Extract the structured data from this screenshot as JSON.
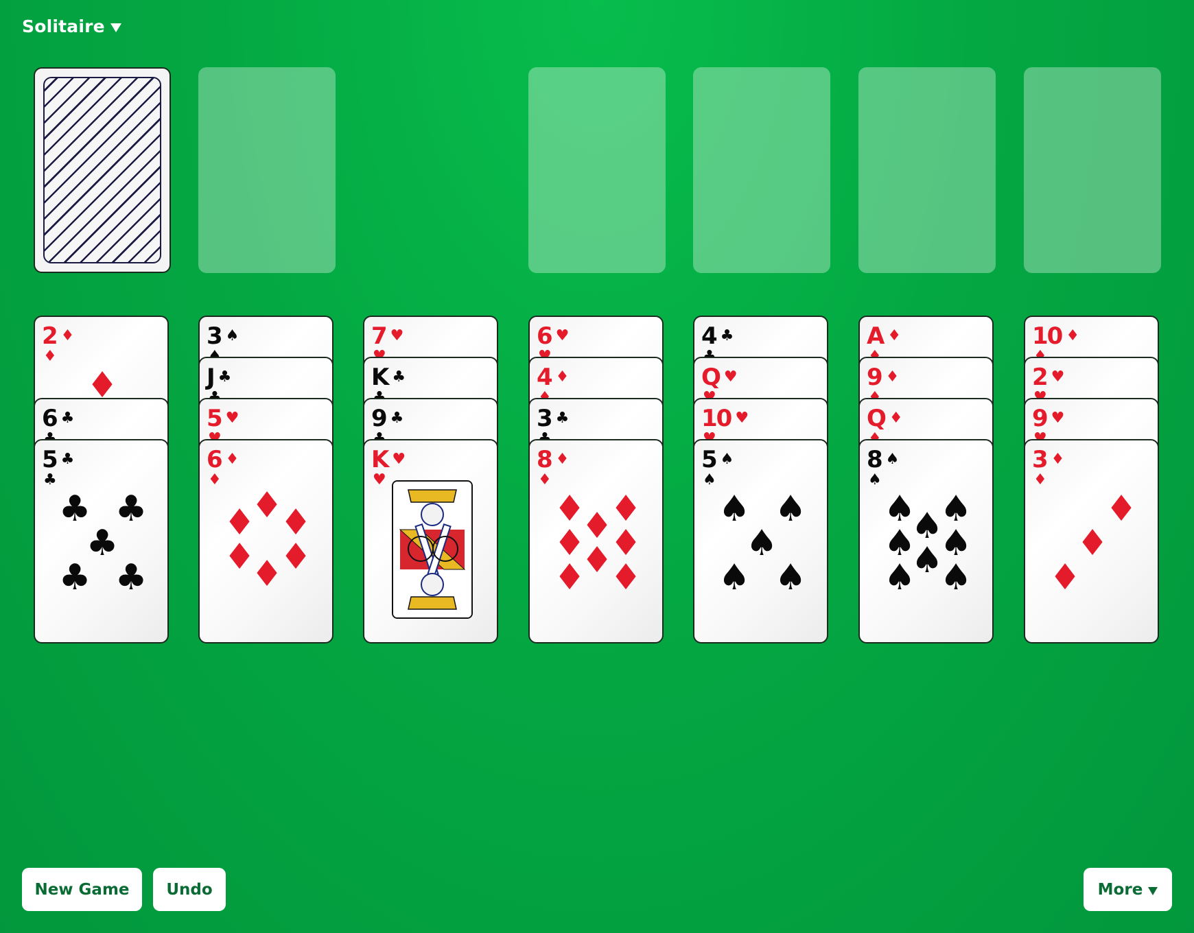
{
  "header": {
    "title": "Solitaire",
    "title_icon": "caret-down-icon"
  },
  "colors": {
    "table_green": "#04a843",
    "button_text": "#0b6b35",
    "red_suit": "#e41b2b",
    "black_suit": "#0a0a0a",
    "card_back_line": "#1a1a44"
  },
  "stock": {
    "face_down": true,
    "pattern": "diagonal-stripes"
  },
  "waste": {
    "empty": true
  },
  "foundations": [
    {
      "empty": true
    },
    {
      "empty": true
    },
    {
      "empty": true
    },
    {
      "empty": true
    }
  ],
  "tableau": [
    [
      {
        "rank": "2",
        "suit": "diamonds"
      },
      {
        "rank": "6",
        "suit": "clubs"
      },
      {
        "rank": "5",
        "suit": "clubs"
      }
    ],
    [
      {
        "rank": "3",
        "suit": "spades"
      },
      {
        "rank": "J",
        "suit": "clubs"
      },
      {
        "rank": "5",
        "suit": "hearts"
      },
      {
        "rank": "6",
        "suit": "diamonds"
      }
    ],
    [
      {
        "rank": "7",
        "suit": "hearts"
      },
      {
        "rank": "K",
        "suit": "clubs"
      },
      {
        "rank": "9",
        "suit": "clubs"
      },
      {
        "rank": "K",
        "suit": "hearts"
      }
    ],
    [
      {
        "rank": "6",
        "suit": "hearts"
      },
      {
        "rank": "4",
        "suit": "diamonds"
      },
      {
        "rank": "3",
        "suit": "clubs"
      },
      {
        "rank": "8",
        "suit": "diamonds"
      }
    ],
    [
      {
        "rank": "4",
        "suit": "clubs"
      },
      {
        "rank": "Q",
        "suit": "hearts"
      },
      {
        "rank": "10",
        "suit": "hearts"
      },
      {
        "rank": "5",
        "suit": "spades"
      }
    ],
    [
      {
        "rank": "A",
        "suit": "diamonds"
      },
      {
        "rank": "9",
        "suit": "diamonds"
      },
      {
        "rank": "Q",
        "suit": "diamonds"
      },
      {
        "rank": "8",
        "suit": "spades"
      }
    ],
    [
      {
        "rank": "10",
        "suit": "diamonds"
      },
      {
        "rank": "2",
        "suit": "hearts"
      },
      {
        "rank": "9",
        "suit": "hearts"
      },
      {
        "rank": "3",
        "suit": "diamonds"
      }
    ]
  ],
  "buttons": {
    "new_game": "New Game",
    "undo": "Undo",
    "more": "More"
  }
}
